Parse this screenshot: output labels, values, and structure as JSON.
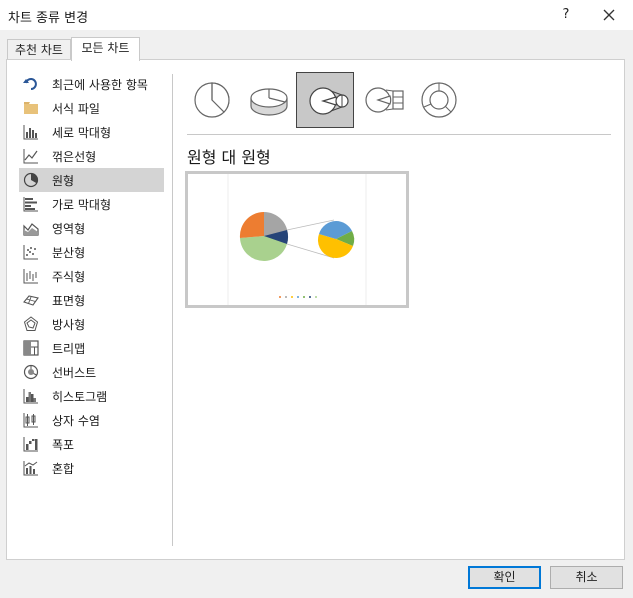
{
  "window": {
    "title": "차트 종류 변경",
    "help_label": "?"
  },
  "tabs": [
    {
      "label": "추천 차트",
      "active": false
    },
    {
      "label": "모든 차트",
      "active": true
    }
  ],
  "sidebar": {
    "selected_index": 4,
    "items": [
      {
        "label": "최근에 사용한 항목",
        "icon": "undo-icon"
      },
      {
        "label": "서식 파일",
        "icon": "folder-icon"
      },
      {
        "label": "세로 막대형",
        "icon": "column-chart-icon"
      },
      {
        "label": "꺾은선형",
        "icon": "line-chart-icon"
      },
      {
        "label": "원형",
        "icon": "pie-chart-icon"
      },
      {
        "label": "가로 막대형",
        "icon": "bar-chart-icon"
      },
      {
        "label": "영역형",
        "icon": "area-chart-icon"
      },
      {
        "label": "분산형",
        "icon": "scatter-chart-icon"
      },
      {
        "label": "주식형",
        "icon": "stock-chart-icon"
      },
      {
        "label": "표면형",
        "icon": "surface-chart-icon"
      },
      {
        "label": "방사형",
        "icon": "radar-chart-icon"
      },
      {
        "label": "트리맵",
        "icon": "treemap-icon"
      },
      {
        "label": "선버스트",
        "icon": "sunburst-icon"
      },
      {
        "label": "히스토그램",
        "icon": "histogram-icon"
      },
      {
        "label": "상자 수염",
        "icon": "box-whisker-icon"
      },
      {
        "label": "폭포",
        "icon": "waterfall-icon"
      },
      {
        "label": "혼합",
        "icon": "combo-chart-icon"
      }
    ]
  },
  "subtypes": {
    "selected_index": 2,
    "items": [
      {
        "icon": "pie-icon"
      },
      {
        "icon": "3d-pie-icon"
      },
      {
        "icon": "pie-of-pie-icon"
      },
      {
        "icon": "bar-of-pie-icon"
      },
      {
        "icon": "doughnut-icon"
      }
    ]
  },
  "preview": {
    "title": "원형 대 원형"
  },
  "colors": {
    "accent": "#0078d7",
    "slice_gray": "#a5a5a5",
    "slice_orange": "#ed7d31",
    "slice_navy": "#264478",
    "slice_green": "#a9d18e",
    "slice_blue": "#5b9bd5",
    "slice_yellow": "#ffc000",
    "slice_lightgreen": "#70ad47"
  },
  "buttons": {
    "ok": "확인",
    "cancel": "취소"
  }
}
